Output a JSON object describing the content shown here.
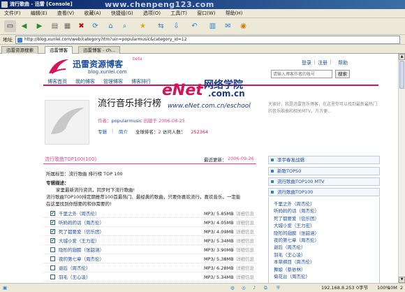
{
  "window": {
    "title": "流行歌曲 - 迅雷 [Console]",
    "watermark_top": "www.chenpeng123.com"
  },
  "menu": [
    "文件(F)",
    "编辑(E)",
    "查看(V)",
    "收藏(A)",
    "快捷组(G)",
    "选项(O)",
    "工具(T)",
    "窗口(W)",
    "帮助(H)"
  ],
  "address": {
    "label": "地址",
    "url": "http://blog.xunlei.com/web/category.htm?uin=popularmusic&category_id=12"
  },
  "tabs": [
    "迅雷资源搜索",
    "迅雷博客",
    "迅雷博客 - ch..."
  ],
  "header": {
    "logo_text": "迅雷资源博客",
    "logo_beta": "beta",
    "logo_url": "blog.xunlei.com",
    "links": [
      "登录",
      "注册",
      "帮助"
    ],
    "search_placeholder": "请输入博客作者的帐号",
    "search_button": "搜索",
    "nav": [
      "博客首页",
      "我的博客",
      "管理博客",
      "博客排行"
    ]
  },
  "watermark": {
    "main": "eNet",
    "cn": "网络学院",
    "suffix": ".com.cn",
    "url": "www.eNet.com.cn/eschool"
  },
  "blog": {
    "title": "流行音乐排行榜",
    "author_label": "作者：",
    "author": "popularmusic",
    "created_label": "创建于",
    "created": "2006-08-25",
    "links": [
      "专辑",
      "简介"
    ],
    "rank_label": "全球排名：",
    "rank": "2",
    "visitors_label": "访问人数：",
    "visitors": "252364",
    "greeting": "大家好，我是迅雷音乐博客，在这里你可以找到最新最热门的音乐歌曲和相关MTV。方方便..."
  },
  "album": {
    "title": "流行歌曲TOP100(100)",
    "updated_label": "最近更新：",
    "updated": "2006-09-26",
    "tags_label": "所属标签：",
    "tags": "流行歌曲  排行榜  TOP 100",
    "desc_label": "专辑描述：",
    "desc_1": "家里最新流行资讯，同步时下流行歌曲!",
    "desc_2": "流行歌曲TOP100排定期推荐100首最热门、最经典的歌曲，只要你喜欢流行，喜欢音乐，一定能",
    "desc_3": "在这里找到你想要的和你需要的!"
  },
  "songs": [
    {
      "title": "千里之外（周杰伦）",
      "format": "MP3/",
      "size": "5.85MB",
      "info": "详细信息",
      "checked": true
    },
    {
      "title": "听妈妈的话（周杰伦）",
      "format": "MP3/",
      "size": "4.05MB",
      "info": "详细信息",
      "checked": true
    },
    {
      "title": "死了都要爱（信乐团）",
      "format": "MP3/",
      "size": "4.09MB",
      "info": "详细信息",
      "checked": true
    },
    {
      "title": "大城小爱（王力宏）",
      "format": "MP3/",
      "size": "5.34MB",
      "info": "详细信息",
      "checked": true
    },
    {
      "title": "隐形的翅膀（张韶涵）",
      "format": "MP3/",
      "size": "3.90MB",
      "info": "详细信息",
      "checked": false
    },
    {
      "title": "夜的第七章（周杰伦）",
      "format": "MP3/",
      "size": "5.38MB",
      "info": "详细信息",
      "checked": false
    },
    {
      "title": "退后（周杰伦）",
      "format": "MP3/",
      "size": "6.28MB",
      "info": "详细信息",
      "checked": false
    },
    {
      "title": "羽毛（王心凌）",
      "format": "MP3/",
      "size": "5.34MB",
      "info": "详细信息",
      "checked": false
    }
  ],
  "sidebar": {
    "boxes": [
      "李宇春发战辑",
      "新歌TOP50",
      "流行歌曲TOP100 MTV",
      "流行歌曲TOP100"
    ],
    "songs": [
      "千里之外（周杰伦）",
      "听妈妈的话（周杰伦）",
      "死了都要爱（信乐团）",
      "大城小爱（王力宏）",
      "隐形的翅膀（张韶涵）",
      "夜的第七章（周杰伦）",
      "退后（周杰伦）",
      "羽毛（王心凌）",
      "本草纲目（周杰伦）",
      "舞娘（蔡依林）",
      "菊花台（周杰伦）"
    ]
  },
  "status": {
    "ip": "192.168.8.253",
    "cells": [
      "0字节",
      "100%",
      "10M",
      "2"
    ]
  }
}
